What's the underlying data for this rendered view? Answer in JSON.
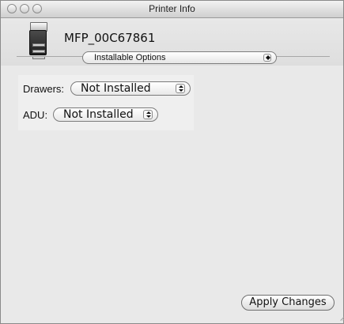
{
  "window": {
    "title": "Printer Info"
  },
  "printer": {
    "name": "MFP_00C67861",
    "icon": "printer-icon"
  },
  "section_popup": {
    "selected": "Installable Options"
  },
  "options": [
    {
      "label": "Drawers:",
      "value": "Not Installed"
    },
    {
      "label": "ADU:",
      "value": "Not Installed"
    }
  ],
  "actions": {
    "apply_label": "Apply Changes"
  }
}
